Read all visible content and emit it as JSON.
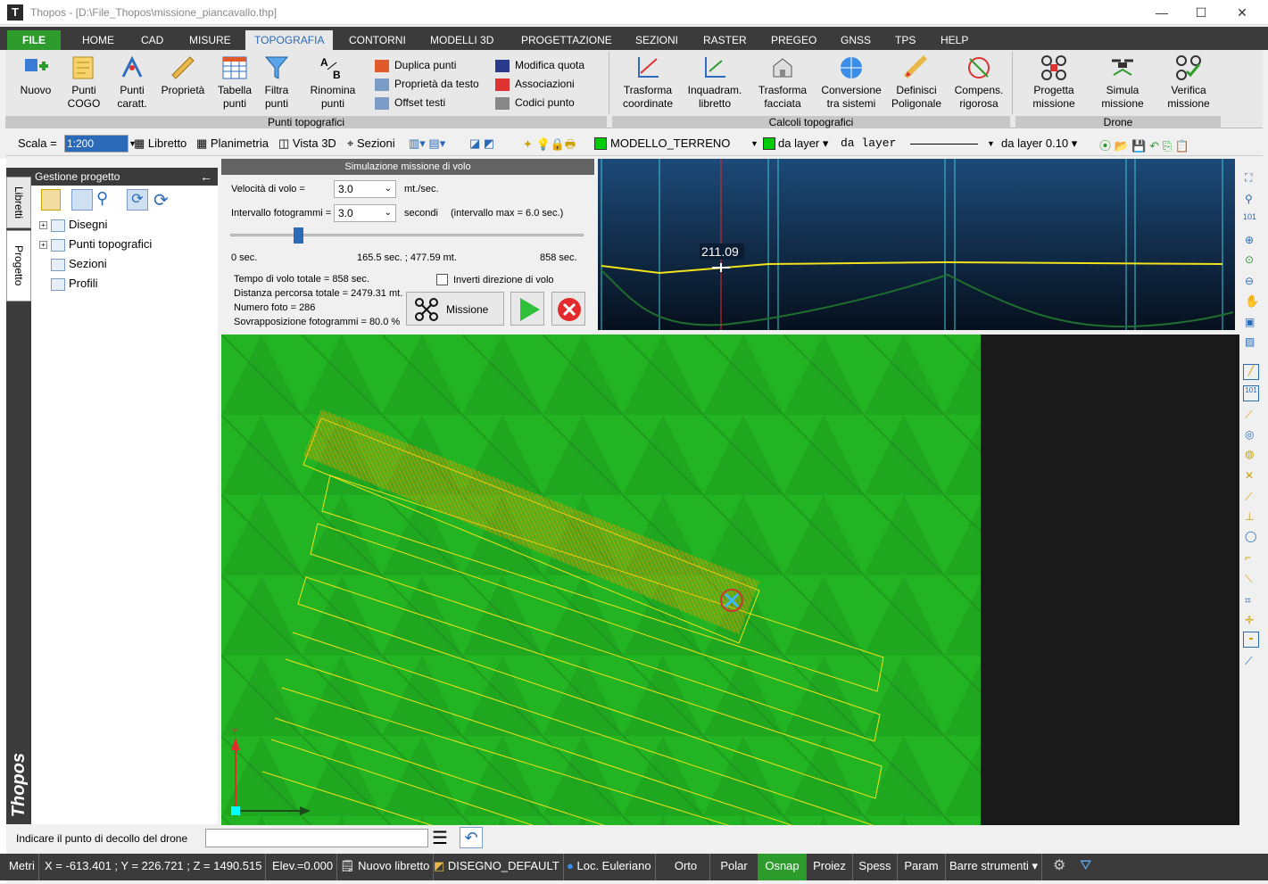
{
  "titlebar": {
    "app": "Thopos",
    "path": "Thopos - [D:\\File_Thopos\\missione_piancavallo.thp]",
    "minimize": "—",
    "maximize": "☐",
    "close": "✕"
  },
  "ribbon_tabs": [
    "FILE",
    "HOME",
    "CAD",
    "MISURE",
    "TOPOGRAFIA",
    "CONTORNI",
    "MODELLI 3D",
    "PROGETTAZIONE",
    "SEZIONI",
    "RASTER",
    "PREGEO",
    "GNSS",
    "TPS",
    "HELP"
  ],
  "active_tab": "TOPOGRAFIA",
  "groups": {
    "punti": {
      "label": "Punti topografici",
      "buttons": [
        {
          "l1": "Nuovo",
          "l2": ""
        },
        {
          "l1": "Punti",
          "l2": "COGO"
        },
        {
          "l1": "Punti",
          "l2": "caratt."
        },
        {
          "l1": "Proprietà",
          "l2": ""
        },
        {
          "l1": "Tabella",
          "l2": "punti"
        },
        {
          "l1": "Filtra",
          "l2": "punti"
        },
        {
          "l1": "Rinomina",
          "l2": "punti"
        }
      ],
      "small1": [
        "Duplica punti",
        "Proprietà da testo",
        "Offset testi"
      ],
      "small2": [
        "Modifica quota",
        "Associazioni",
        "Codici punto"
      ]
    },
    "calcoli": {
      "label": "Calcoli topografici",
      "buttons": [
        {
          "l1": "Trasforma",
          "l2": "coordinate"
        },
        {
          "l1": "Inquadram.",
          "l2": "libretto"
        },
        {
          "l1": "Trasforma",
          "l2": "facciata"
        },
        {
          "l1": "Conversione",
          "l2": "tra sistemi"
        },
        {
          "l1": "Definisci",
          "l2": "Poligonale"
        },
        {
          "l1": "Compens.",
          "l2": "rigorosa"
        }
      ]
    },
    "drone": {
      "label": "Drone",
      "buttons": [
        {
          "l1": "Progetta",
          "l2": "missione"
        },
        {
          "l1": "Simula",
          "l2": "missione"
        },
        {
          "l1": "Verifica",
          "l2": "missione"
        }
      ]
    }
  },
  "toolbar": {
    "scala_label": "Scala =",
    "scala_value": "1:200",
    "libretto": "Libretto",
    "planimetria": "Planimetria",
    "vista3d": "Vista 3D",
    "sezioni": "Sezioni",
    "layer": "MODELLO_TERRENO",
    "color1": "da layer",
    "linetype": "da layer",
    "lineweight": "da layer 0.10"
  },
  "panel": {
    "title": "Gestione progetto",
    "tabs": [
      "Libretti",
      "Progetto"
    ],
    "brand": "Thopos",
    "tree": [
      "Disegni",
      "Punti topografici",
      "Sezioni",
      "Profili"
    ]
  },
  "sim": {
    "title": "Simulazione missione di volo",
    "speed_label": "Velocità di volo =",
    "speed_value": "3.0",
    "speed_unit": "mt./sec.",
    "interval_label": "Intervallo fotogrammi =",
    "interval_value": "3.0",
    "interval_unit": "secondi",
    "interval_max": "(intervallo max = 6.0 sec.)",
    "slider_start": "0 sec.",
    "slider_mid": "165.5 sec. ; 477.59 mt.",
    "slider_end": "858 sec.",
    "slider_pos": 0.193,
    "stats": [
      "Tempo di volo totale = 858 sec.",
      "Distanza percorsa totale = 2479.31 mt.",
      "Numero foto = 286",
      "Sovrapposizione fotogrammi = 80.0 %"
    ],
    "invert_label": "Inverti direzione di volo",
    "mission_btn": "Missione"
  },
  "profile": {
    "altitude": "211.09"
  },
  "map": {
    "axis_y": "Y"
  },
  "cmd": {
    "prompt": "Indicare il punto di decollo del drone",
    "input": ""
  },
  "status": {
    "units": "Metri",
    "coords": "X = -613.401 ; Y = 226.721 ; Z = 1490.515",
    "elev": "Elev.=0.000",
    "nuovo": "Nuovo libretto",
    "disegno": "DISEGNO_DEFAULT",
    "loc": "Loc. Euleriano",
    "orto": "Orto",
    "polar": "Polar",
    "osnap": "Osnap",
    "proiez": "Proiez",
    "spess": "Spess",
    "param": "Param",
    "barre": "Barre strumenti"
  },
  "colors": {
    "accent": "#2d9c2d",
    "dark": "#3b3b3b",
    "map": "#22b422",
    "flight": "#ffd21e"
  }
}
